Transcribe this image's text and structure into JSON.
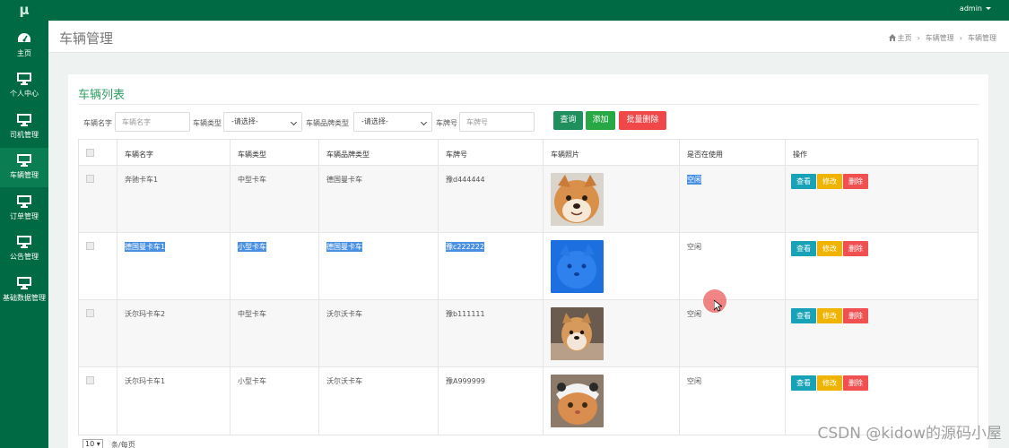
{
  "app": {
    "logo": "μ",
    "user": "admin"
  },
  "sidebar": {
    "items": [
      {
        "label": "主页",
        "icon": "dashboard-icon"
      },
      {
        "label": "个人中心",
        "icon": "monitor-icon"
      },
      {
        "label": "司机管理",
        "icon": "monitor-icon"
      },
      {
        "label": "车辆管理",
        "icon": "monitor-icon"
      },
      {
        "label": "订单管理",
        "icon": "monitor-icon"
      },
      {
        "label": "公告管理",
        "icon": "monitor-icon"
      },
      {
        "label": "基础数据管理",
        "icon": "monitor-icon"
      }
    ]
  },
  "header": {
    "title": "车辆管理",
    "breadcrumb": [
      "主页",
      "车辆管理",
      "车辆管理"
    ]
  },
  "card": {
    "title": "车辆列表"
  },
  "search": {
    "name_label": "车辆名字",
    "name_placeholder": "车辆名字",
    "type_label": "车辆类型",
    "type_value": "-请选择-",
    "brand_label": "车辆品牌类型",
    "brand_value": "-请选择-",
    "plate_label": "车牌号",
    "plate_placeholder": "车牌号",
    "query_btn": "查询",
    "add_btn": "添加",
    "batch_delete_btn": "批量删除"
  },
  "table": {
    "headers": [
      "车辆名字",
      "车辆类型",
      "车辆品牌类型",
      "车牌号",
      "车辆照片",
      "是否在使用",
      "操作"
    ],
    "rows": [
      {
        "name": "奔驰卡车1",
        "type": "中型卡车",
        "brand": "德国曼卡车",
        "plate": "豫d444444",
        "status": "空闲",
        "photo": "shiba-photo"
      },
      {
        "name": "德国曼卡车1",
        "type": "小型卡车",
        "brand": "德国曼卡车",
        "plate": "豫c222222",
        "status": "空闲",
        "photo": "blue-tinted-photo"
      },
      {
        "name": "沃尔玛卡车2",
        "type": "中型卡车",
        "brand": "沃尔沃卡车",
        "plate": "豫b111111",
        "status": "空闲",
        "photo": "puppy-photo"
      },
      {
        "name": "沃尔玛卡车1",
        "type": "小型卡车",
        "brand": "沃尔沃卡车",
        "plate": "豫A999999",
        "status": "空闲",
        "photo": "cat-photo"
      }
    ],
    "actions": {
      "view": "查看",
      "edit": "修改",
      "delete": "删除"
    }
  },
  "pagination": {
    "page_size": "10",
    "per_page_text": "条/每页"
  },
  "watermark": "CSDN @kidow的源码小屋",
  "colors": {
    "primary": "#006a45",
    "sidebar_active": "#0b7d52",
    "title_green": "#2f9e64",
    "query": "#1f8f5e",
    "add": "#28a745",
    "danger": "#f04848",
    "view": "#17a2b8",
    "edit": "#f0b400",
    "highlight": "#4a90e2"
  }
}
